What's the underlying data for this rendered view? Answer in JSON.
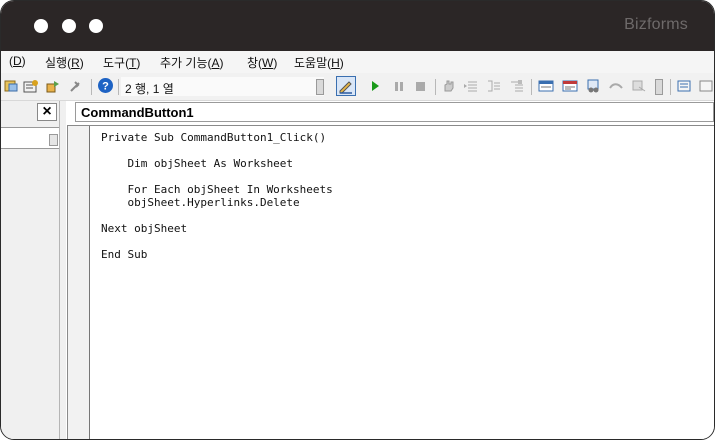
{
  "window": {
    "brand": "Bizforms"
  },
  "menu": {
    "items": [
      {
        "prefix": "(",
        "key": "D",
        "suffix": ")"
      },
      {
        "prefix": "실행(",
        "key": "R",
        "suffix": ")"
      },
      {
        "prefix": "도구(",
        "key": "T",
        "suffix": ")"
      },
      {
        "prefix": "추가 기능(",
        "key": "A",
        "suffix": ")"
      },
      {
        "prefix": "창(",
        "key": "W",
        "suffix": ")"
      },
      {
        "prefix": "도움말(",
        "key": "H",
        "suffix": ")"
      }
    ]
  },
  "toolbar": {
    "position_text": "2 행, 1 열",
    "icons": [
      "project-explorer-icon",
      "properties-icon",
      "object-browser-icon",
      "toolbox-icon",
      "help-icon",
      "design-mode-icon",
      "run-icon",
      "break-icon",
      "reset-icon",
      "toggle-breakpoint-icon",
      "indent-icon",
      "outdent-icon",
      "list-members-icon",
      "quick-info-icon",
      "comment-block-icon",
      "bookmark-icon"
    ]
  },
  "object_box": {
    "value": "CommandButton1"
  },
  "code": {
    "lines": [
      "Private Sub CommandButton1_Click()",
      "",
      "    Dim objSheet As Worksheet",
      "",
      "    For Each objSheet In Worksheets",
      "    objSheet.Hyperlinks.Delete",
      "",
      "Next objSheet",
      "",
      "End Sub"
    ]
  },
  "colors": {
    "titlebar": "#2b2626",
    "run": "#1a9a1a",
    "help": "#1e63c4"
  }
}
